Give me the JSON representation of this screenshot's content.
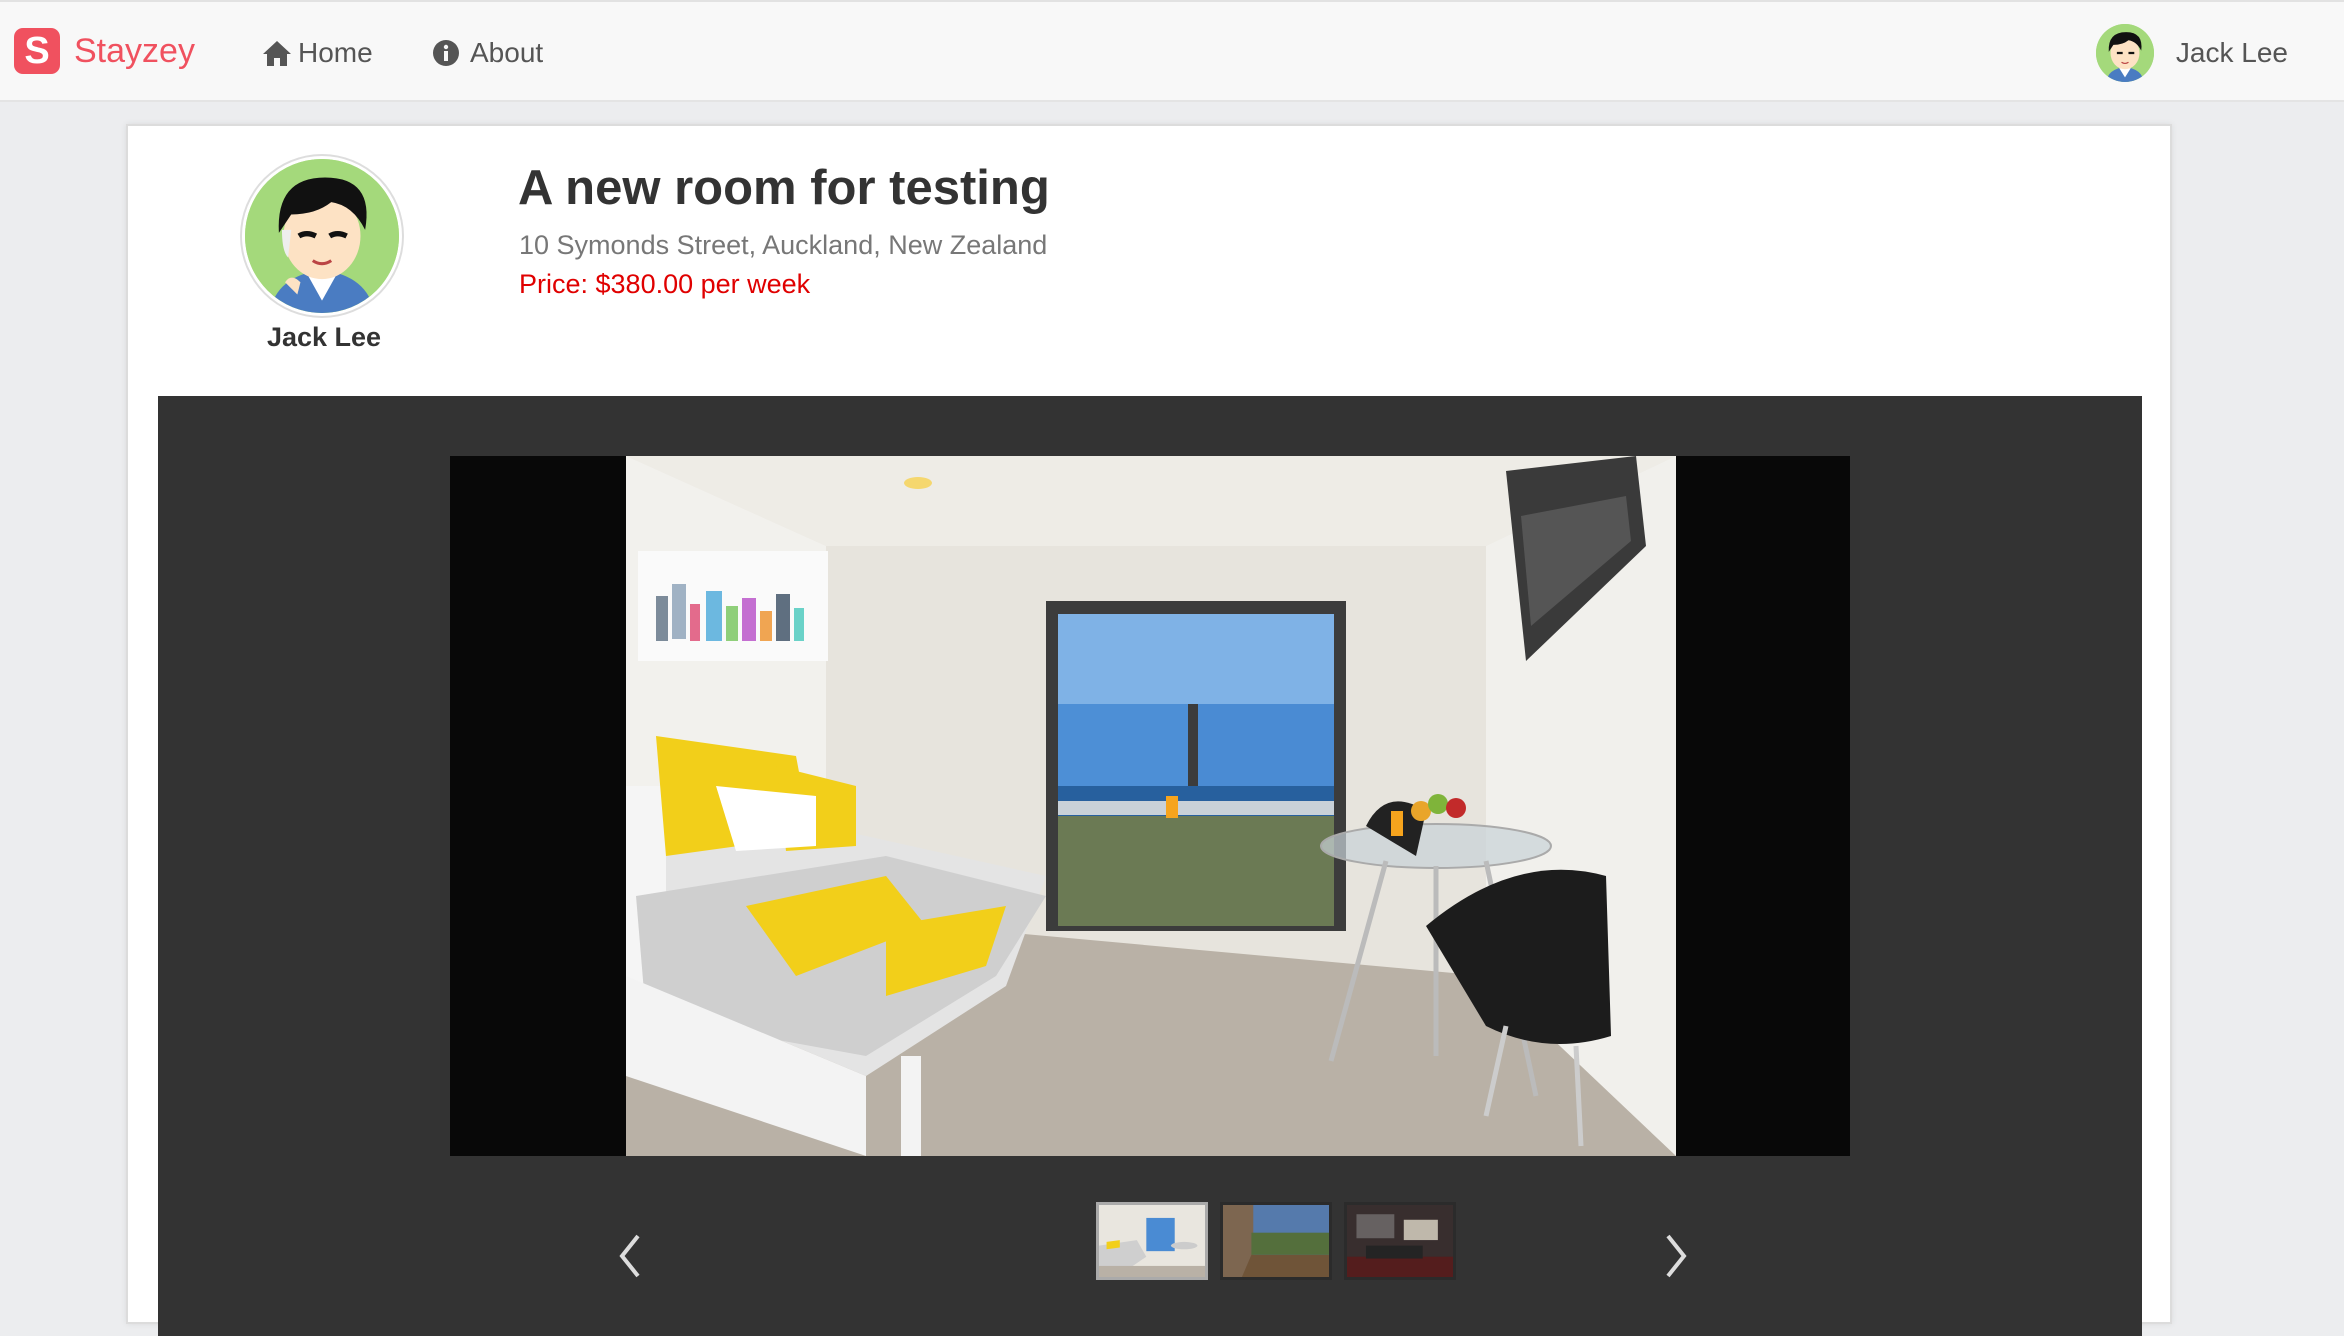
{
  "navbar": {
    "brand_letter": "S",
    "brand_name": "Stayzey",
    "home_label": "Home",
    "about_label": "About",
    "user_name": "Jack Lee"
  },
  "listing": {
    "host_name": "Jack Lee",
    "title": "A new room for testing",
    "address": "10 Symonds Street, Auckland, New Zealand",
    "price": "Price: $380.00 per week"
  },
  "gallery": {
    "thumbnails": [
      "bedroom",
      "deck",
      "living-room"
    ],
    "active_index": 0
  },
  "colors": {
    "brand": "#f0515f",
    "price": "#e00000",
    "gallery_bg": "#333333"
  },
  "icons": [
    "home-icon",
    "info-icon",
    "chevron-left-icon",
    "chevron-right-icon"
  ]
}
